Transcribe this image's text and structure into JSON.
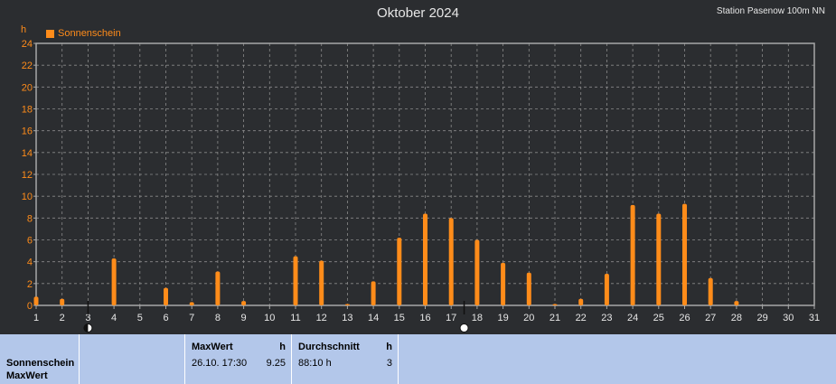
{
  "chart_data": {
    "type": "bar",
    "title": "Oktober 2024",
    "station": "Station Pasenow 100m NN",
    "ylabel": "h",
    "ylim": [
      0,
      24
    ],
    "yticks": [
      0,
      2,
      4,
      6,
      8,
      10,
      12,
      14,
      16,
      18,
      20,
      22,
      24
    ],
    "categories": [
      "1",
      "2",
      "3",
      "4",
      "5",
      "6",
      "7",
      "8",
      "9",
      "10",
      "11",
      "12",
      "13",
      "14",
      "15",
      "16",
      "17",
      "18",
      "19",
      "20",
      "21",
      "22",
      "23",
      "24",
      "25",
      "26",
      "27",
      "28",
      "29",
      "30",
      "31"
    ],
    "series": [
      {
        "name": "Sonnenschein",
        "color": "#ff8c1a",
        "values": [
          0.8,
          0.6,
          0.0,
          4.3,
          0.0,
          1.6,
          0.3,
          3.1,
          0.4,
          0.0,
          4.5,
          4.1,
          0.1,
          2.2,
          6.2,
          8.4,
          8.0,
          6.0,
          3.9,
          3.0,
          0.1,
          0.6,
          2.9,
          9.2,
          8.4,
          9.3,
          2.5,
          0.4,
          0.0,
          0.0
        ]
      }
    ],
    "grid": true,
    "legend_position": "top-left",
    "markers": [
      {
        "day": 3,
        "symbol": "new-moon-icon"
      },
      {
        "day": 17.5,
        "symbol": "full-moon-icon"
      }
    ]
  },
  "footer": {
    "row_label_1": "Sonnenschein",
    "row_label_2": "MaxWert",
    "max_header": "MaxWert",
    "max_unit": "h",
    "max_time": "26.10.  17:30",
    "max_value": "9.25",
    "avg_header": "Durchschnitt",
    "avg_unit": "h",
    "avg_value": "88:10 h",
    "avg_count": "3"
  }
}
